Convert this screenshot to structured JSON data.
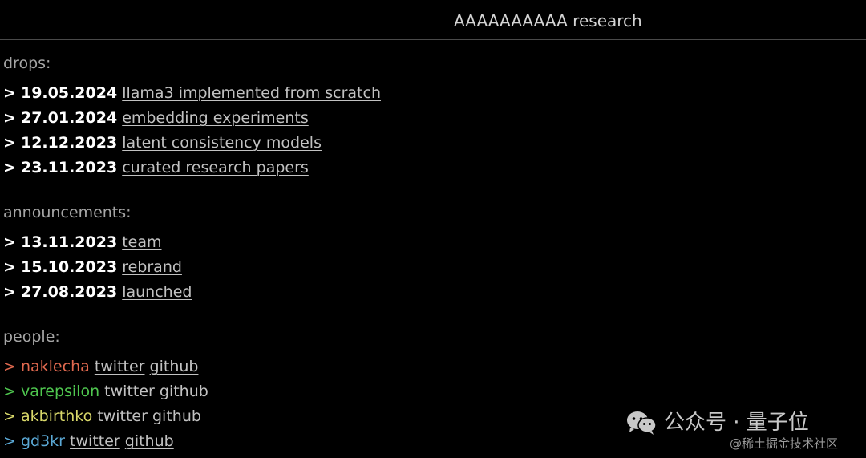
{
  "header": {
    "title": "AAAAAAAAAA research"
  },
  "sections": {
    "drops": {
      "heading": "drops:",
      "items": [
        {
          "arrow": ">",
          "date": "19.05.2024",
          "link": "llama3 implemented from scratch"
        },
        {
          "arrow": ">",
          "date": "27.01.2024",
          "link": "embedding experiments"
        },
        {
          "arrow": ">",
          "date": "12.12.2023",
          "link": "latent consistency models"
        },
        {
          "arrow": ">",
          "date": "23.11.2023",
          "link": "curated research papers"
        }
      ]
    },
    "announcements": {
      "heading": "announcements:",
      "items": [
        {
          "arrow": ">",
          "date": "13.11.2023",
          "link": "team"
        },
        {
          "arrow": ">",
          "date": "15.10.2023",
          "link": "rebrand"
        },
        {
          "arrow": ">",
          "date": "27.08.2023",
          "link": "launched"
        }
      ]
    },
    "people": {
      "heading": "people:",
      "items": [
        {
          "arrow": ">",
          "name": "naklecha",
          "color": "#e0694f",
          "twitter": "twitter",
          "github": "github"
        },
        {
          "arrow": ">",
          "name": "varepsilon",
          "color": "#4fc74f",
          "twitter": "twitter",
          "github": "github"
        },
        {
          "arrow": ">",
          "name": "akbirthko",
          "color": "#d9d86a",
          "twitter": "twitter",
          "github": "github"
        },
        {
          "arrow": ">",
          "name": "gd3kr",
          "color": "#5ba9d6",
          "twitter": "twitter",
          "github": "github"
        }
      ]
    }
  },
  "watermark": {
    "icon": "wechat-icon",
    "account": "公众号 · 量子位",
    "source": "@稀土掘金技术社区"
  }
}
